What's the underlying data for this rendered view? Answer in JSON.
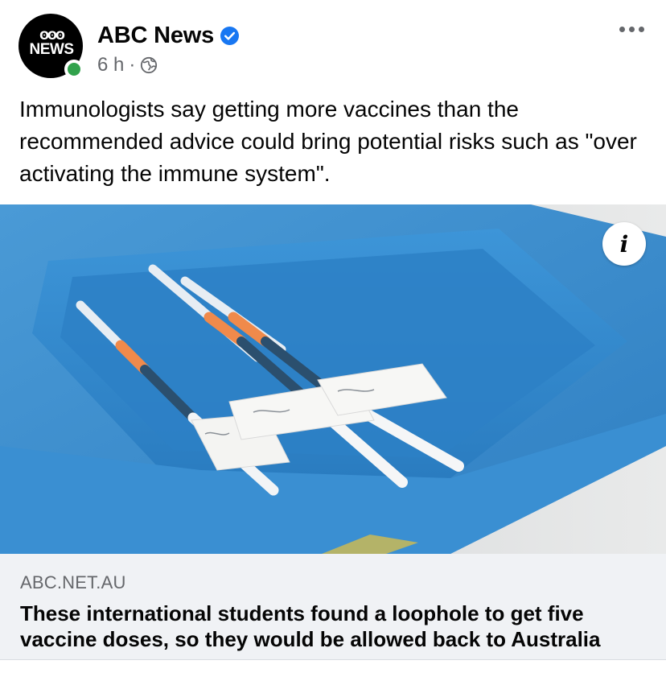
{
  "post": {
    "page_name": "ABC News",
    "time": "6 h",
    "separator": "·",
    "avatar_logo_mark": "ʘʘʘ",
    "avatar_logo_text": "NEWS",
    "body_text": "Immunologists say getting more vaccines than the recommended advice could bring potential risks such as \"over activating the immune system\"."
  },
  "link": {
    "domain": "ABC.NET.AU",
    "title": "These international students found a loophole to get five vaccine doses, so they would be allowed back to Australia",
    "info_glyph": "i"
  },
  "icons": {
    "verified": "verified-badge-icon",
    "audience": "globe-icon",
    "more": "more-options-icon",
    "info": "info-icon"
  },
  "colors": {
    "verified_blue": "#1877f2",
    "online_green": "#31a24c",
    "meta_gray": "#65676b",
    "card_background": "#f0f2f5"
  }
}
